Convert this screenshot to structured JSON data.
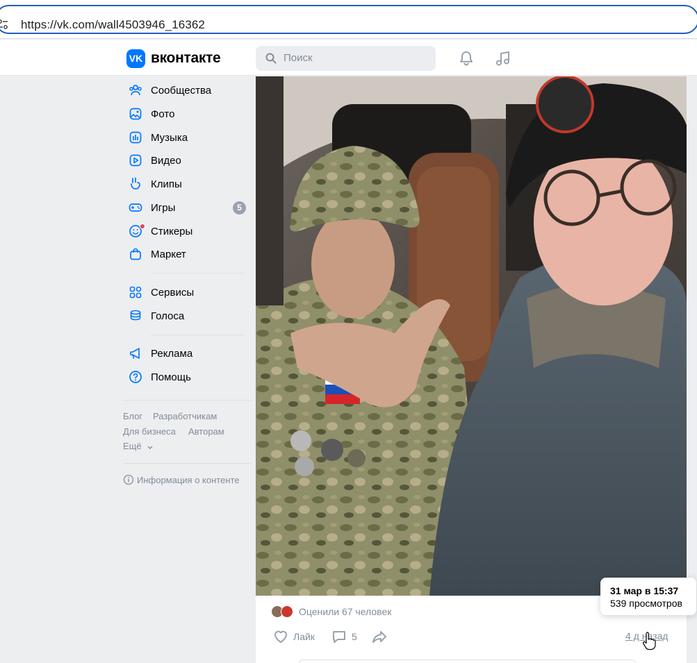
{
  "browser": {
    "url": "https://vk.com/wall4503946_16362"
  },
  "header": {
    "logo_badge": "VK",
    "logo_text": "вконтакте",
    "search_placeholder": "Поиск"
  },
  "sidebar": {
    "items": [
      {
        "label": "Сообщества",
        "icon": "communities-icon"
      },
      {
        "label": "Фото",
        "icon": "photo-icon"
      },
      {
        "label": "Музыка",
        "icon": "music-icon"
      },
      {
        "label": "Видео",
        "icon": "video-icon"
      },
      {
        "label": "Клипы",
        "icon": "clips-icon"
      },
      {
        "label": "Игры",
        "icon": "games-icon",
        "badge": "5"
      },
      {
        "label": "Стикеры",
        "icon": "stickers-icon"
      },
      {
        "label": "Маркет",
        "icon": "market-icon"
      },
      {
        "label": "Сервисы",
        "icon": "services-icon"
      },
      {
        "label": "Голоса",
        "icon": "votes-icon"
      },
      {
        "label": "Реклама",
        "icon": "ads-icon"
      },
      {
        "label": "Помощь",
        "icon": "help-icon"
      }
    ],
    "footer": {
      "blog": "Блог",
      "developers": "Разработчикам",
      "business": "Для бизнеса",
      "authors": "Авторам",
      "more": "Ещё"
    },
    "content_info": "Информация о контенте"
  },
  "post": {
    "reactions_text": "Оценили 67 человек",
    "like_label": "Лайк",
    "comments_count": "5",
    "timestamp": "4 д назад"
  },
  "tooltip": {
    "date": "31 мар в 15:37",
    "views": "539 просмотров"
  },
  "colors": {
    "accent": "#0077ff",
    "secondary_text": "#818c99",
    "badge": "#99a2ad",
    "background": "#edeef0"
  }
}
